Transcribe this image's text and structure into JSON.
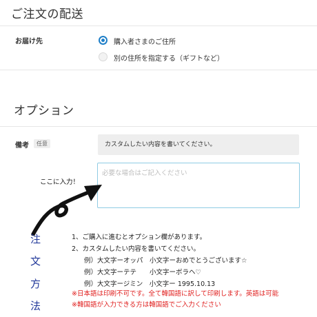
{
  "delivery": {
    "title": "ご注文の配送",
    "recipient_label": "お届け先",
    "options": [
      {
        "label": "購入者さまのご住所",
        "selected": true
      },
      {
        "label": "別の住所を指定する（ギフトなど）",
        "selected": false
      }
    ]
  },
  "options_section": {
    "title": "オプション",
    "remarks_label": "備考",
    "optional_badge": "任意",
    "example_text": "カスタムしたい内容を書いてください。",
    "textarea_placeholder": "必要な場合はご記入ください"
  },
  "annotation": {
    "arrow_text": "ここに入力！"
  },
  "instructions": {
    "vertical_title": [
      "注",
      "文",
      "方",
      "法"
    ],
    "lines": [
      "1、ご購入に進むとオプション欄があります。",
      "2、カスタムしたい内容を書いてください。",
      "例）大文字ーオッパ　小文字ーおめでとうございます☆",
      "例）大文字ーテテ　　小文字ーボラヘ♡",
      "例）大文字ージミン　小文字ー 1995.10.13"
    ],
    "notes": [
      "※日本語は印刷不可です。全て韓国語に訳して印刷します。英語は可能",
      "※韓国語が入力できる方は韓国語でご入力ください"
    ],
    "note_color": "#e0201f",
    "title_color": "#22399a"
  },
  "colors": {
    "accent": "#1e7fc8",
    "textarea_border": "#8ecbe3"
  }
}
